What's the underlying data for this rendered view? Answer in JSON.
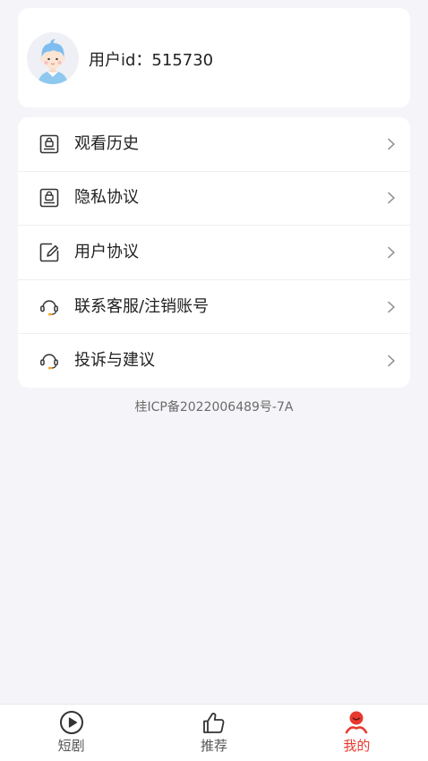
{
  "colors": {
    "page_background": "#f5f5f9",
    "card_background": "#ffffff",
    "text_primary": "#222222",
    "text_muted": "#6b6b6b",
    "chevron": "#8a8a8a",
    "tab_active": "#e8392f",
    "tab_inactive": "#333333",
    "headset_accent": "#f5a623",
    "avatar_hair": "#7fbdf0"
  },
  "profile": {
    "avatar_icon": "boy-avatar-icon",
    "user_id_text": "用户id：515730"
  },
  "menu": {
    "items": [
      {
        "label": "观看历史",
        "icon": "lock-document-icon",
        "trailing_icon": "chevron-right-icon"
      },
      {
        "label": "隐私协议",
        "icon": "lock-document-icon",
        "trailing_icon": "chevron-right-icon"
      },
      {
        "label": "用户协议",
        "icon": "edit-document-icon",
        "trailing_icon": "chevron-right-icon"
      },
      {
        "label": "联系客服/注销账号",
        "icon": "headset-icon",
        "trailing_icon": "chevron-right-icon"
      },
      {
        "label": "投诉与建议",
        "icon": "headset-icon",
        "trailing_icon": "chevron-right-icon"
      }
    ]
  },
  "footer": {
    "icp_text": "桂ICP备2022006489号-7A"
  },
  "tabbar": {
    "items": [
      {
        "label": "短剧",
        "icon": "play-circle-icon",
        "active": false
      },
      {
        "label": "推荐",
        "icon": "thumbs-up-icon",
        "active": false
      },
      {
        "label": "我的",
        "icon": "user-profile-icon",
        "active": true
      }
    ]
  }
}
